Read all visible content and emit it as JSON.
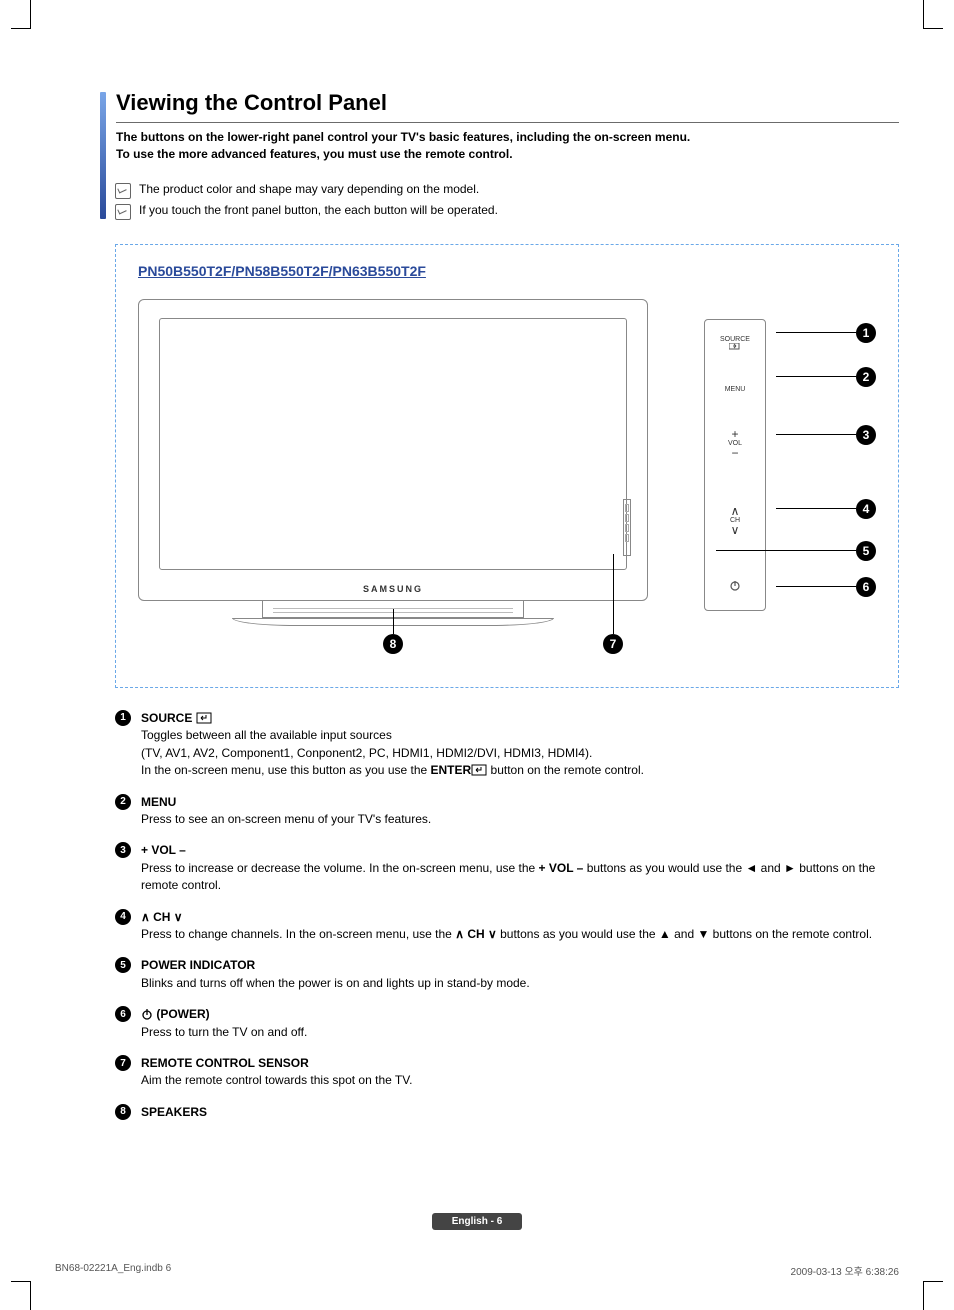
{
  "heading": "Viewing the Control Panel",
  "intro_line1": "The buttons on the lower-right panel control your TV's basic features, including the on-screen menu.",
  "intro_line2": "To use the more advanced features, you must use the remote control.",
  "notes": [
    "The product color and shape may vary depending on the model.",
    "If you touch the front panel button, the each button will be operated."
  ],
  "models": "PN50B550T2F/PN58B550T2F/PN63B550T2F",
  "tv_logo": "SAMSUNG",
  "panel": {
    "source": "SOURCE",
    "menu": "MENU",
    "vol": "VOL",
    "ch": "CH"
  },
  "callouts": [
    "1",
    "2",
    "3",
    "4",
    "5",
    "6",
    "7",
    "8"
  ],
  "items": [
    {
      "num": "1",
      "title": "SOURCE",
      "has_enter_icon": true,
      "body1": "Toggles between all the available input sources",
      "body2": "(TV, AV1, AV2, Component1, Conponent2, PC, HDMI1, HDMI2/DVI, HDMI3, HDMI4).",
      "body3_pre": "In the on-screen menu, use this button as you use the ",
      "body3_bold": "ENTER",
      "body3_post": " button on the remote control."
    },
    {
      "num": "2",
      "title": "MENU",
      "body1": "Press to see an on-screen menu of your TV's features."
    },
    {
      "num": "3",
      "title": "+ VOL –",
      "body1_pre": "Press to increase or decrease the volume. In the on-screen menu, use the ",
      "body1_bold": "+ VOL –",
      "body1_post": " buttons as you would use the ◄ and ► buttons on the remote control."
    },
    {
      "num": "4",
      "title_pre": "∧ ",
      "title_mid": "CH",
      "title_post": " ∨",
      "body1_pre": "Press to change channels. In the on-screen menu, use the ",
      "body1_bold": "∧ CH ∨",
      "body1_post": " buttons as you would use the ▲ and ▼ buttons on the remote control."
    },
    {
      "num": "5",
      "title": "POWER INDICATOR",
      "body1": "Blinks and turns off when the power is on and lights up in stand-by mode."
    },
    {
      "num": "6",
      "title": "(POWER)",
      "has_power_icon": true,
      "body1": "Press to turn the TV on and off."
    },
    {
      "num": "7",
      "title": "REMOTE CONTROL SENSOR",
      "body1": "Aim the remote control towards this spot on the TV."
    },
    {
      "num": "8",
      "title": "SPEAKERS"
    }
  ],
  "footer_page": "English - 6",
  "print_footer_left": "BN68-02221A_Eng.indb   6",
  "print_footer_right": "2009-03-13   오후 6:38:26"
}
